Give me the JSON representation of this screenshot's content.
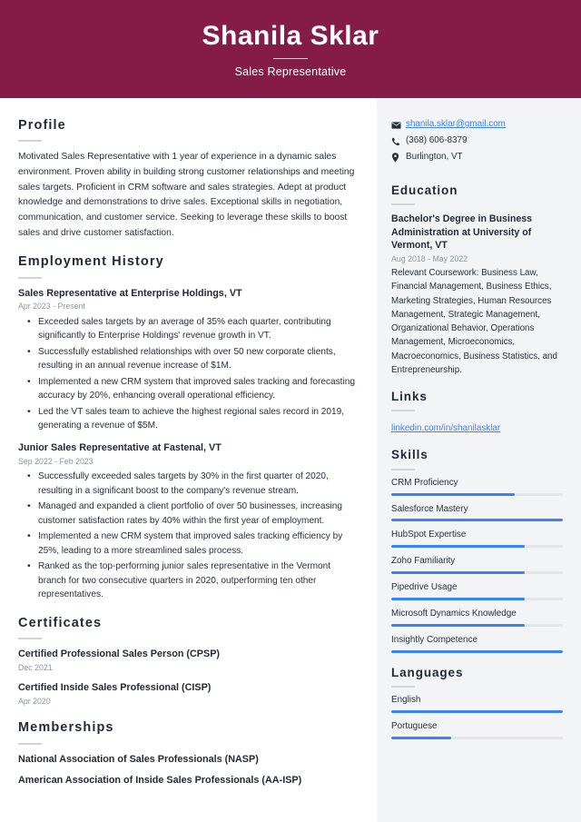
{
  "header": {
    "name": "Shanila Sklar",
    "job_title": "Sales Representative"
  },
  "colors": {
    "header_background": "#851b47",
    "sidebar_background": "#f3f4f6",
    "accent_link": "#3b82f6",
    "skill_bar_fill": "#3b82f6",
    "skill_bar_track": "#e2e5e9",
    "heading_text": "#1f2937",
    "body_text": "#25303f",
    "muted_text": "#8b95a3"
  },
  "main": {
    "profile": {
      "heading": "Profile",
      "text": "Motivated Sales Representative with 1 year of experience in a dynamic sales environment. Proven ability in building strong customer relationships and meeting sales targets. Proficient in CRM software and sales strategies. Adept at product knowledge and demonstrations to drive sales. Exceptional skills in negotiation, communication, and customer service. Seeking to leverage these skills to boost sales and drive customer satisfaction."
    },
    "employment": {
      "heading": "Employment History",
      "jobs": [
        {
          "title": "Sales Representative at Enterprise Holdings, VT",
          "date": "Apr 2023 - Present",
          "bullets": [
            "Exceeded sales targets by an average of 35% each quarter, contributing significantly to Enterprise Holdings' revenue growth in VT.",
            "Successfully established relationships with over 50 new corporate clients, resulting in an annual revenue increase of $1M.",
            "Implemented a new CRM system that improved sales tracking and forecasting accuracy by 20%, enhancing overall operational efficiency.",
            "Led the VT sales team to achieve the highest regional sales record in 2019, generating a revenue of $5M."
          ]
        },
        {
          "title": "Junior Sales Representative at Fastenal, VT",
          "date": "Sep 2022 - Feb 2023",
          "bullets": [
            "Successfully exceeded sales targets by 30% in the first quarter of 2020, resulting in a significant boost to the company's revenue stream.",
            "Managed and expanded a client portfolio of over 50 businesses, increasing customer satisfaction rates by 40% within the first year of employment.",
            "Implemented a new CRM system that improved sales tracking efficiency by 25%, leading to a more streamlined sales process.",
            "Ranked as the top-performing junior sales representative in the Vermont branch for two consecutive quarters in 2020, outperforming ten other representatives."
          ]
        }
      ]
    },
    "certificates": {
      "heading": "Certificates",
      "items": [
        {
          "title": "Certified Professional Sales Person (CPSP)",
          "date": "Dec 2021"
        },
        {
          "title": "Certified Inside Sales Professional (CISP)",
          "date": "Apr 2020"
        }
      ]
    },
    "memberships": {
      "heading": "Memberships",
      "items": [
        {
          "title": "National Association of Sales Professionals (NASP)"
        },
        {
          "title": "American Association of Inside Sales Professionals (AA-ISP)"
        }
      ]
    }
  },
  "sidebar": {
    "contact": {
      "email": "shanila.sklar@gmail.com",
      "phone": "(368) 606-8379",
      "location": "Burlington, VT",
      "email_icon": "envelope-icon",
      "phone_icon": "phone-icon",
      "location_icon": "map-pin-icon"
    },
    "education": {
      "heading": "Education",
      "items": [
        {
          "title": "Bachelor's Degree in Business Administration at University of Vermont, VT",
          "date": "Aug 2018 - May 2022",
          "description": "Relevant Coursework: Business Law, Financial Management, Business Ethics, Marketing Strategies, Human Resources Management, Strategic Management, Organizational Behavior, Operations Management, Microeconomics, Macroeconomics, Business Statistics, and Entrepreneurship."
        }
      ]
    },
    "links": {
      "heading": "Links",
      "items": [
        {
          "label": "linkedin.com/in/shanilasklar"
        }
      ]
    },
    "skills": {
      "heading": "Skills",
      "items": [
        {
          "label": "CRM Proficiency",
          "level": 72
        },
        {
          "label": "Salesforce Mastery",
          "level": 100
        },
        {
          "label": "HubSpot Expertise",
          "level": 78
        },
        {
          "label": "Zoho Familiarity",
          "level": 78
        },
        {
          "label": "Pipedrive Usage",
          "level": 78
        },
        {
          "label": "Microsoft Dynamics Knowledge",
          "level": 78
        },
        {
          "label": "Insightly Competence",
          "level": 100
        }
      ]
    },
    "languages": {
      "heading": "Languages",
      "items": [
        {
          "label": "English",
          "level": 100
        },
        {
          "label": "Portuguese",
          "level": 35
        }
      ]
    }
  }
}
